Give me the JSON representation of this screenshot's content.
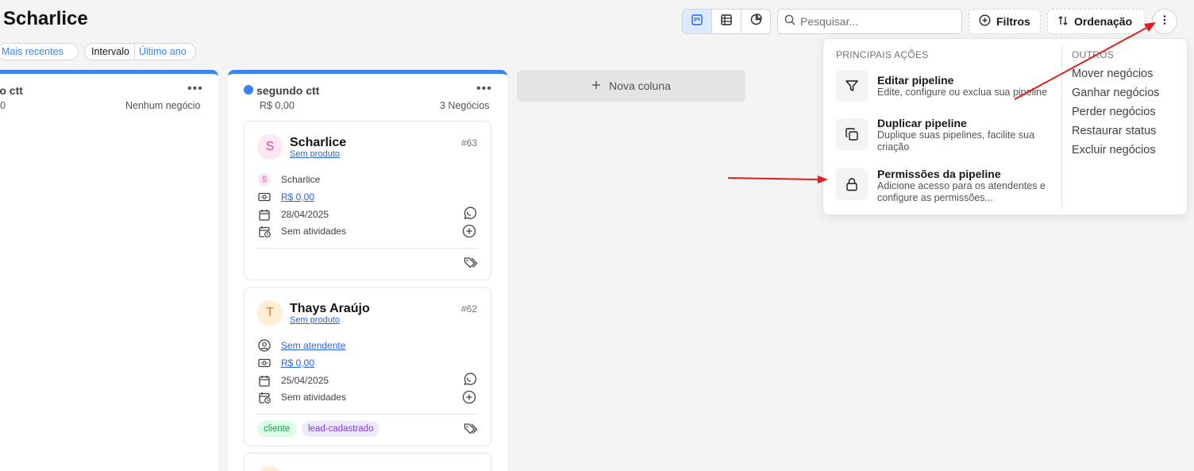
{
  "page": {
    "title": "Scharlice"
  },
  "filters": {
    "sort_value": "Mais recentes",
    "interval_label": "Intervalo",
    "interval_value": "Último ano"
  },
  "toolbar": {
    "view_icons": [
      "kanban-icon",
      "table-icon",
      "pie-chart-icon"
    ],
    "search_placeholder": "Pesquisar...",
    "filters_label": "Filtros",
    "sort_label": "Ordenação",
    "accent": "#3b82f6"
  },
  "columns": [
    {
      "name": "iro ctt",
      "value": "0",
      "count": "Nenhum negócio"
    },
    {
      "name": "segundo ctt",
      "value": "R$ 0,00",
      "count": "3 Negócios",
      "dot_color": "#3b82f6",
      "cards": [
        {
          "initial": "S",
          "name": "Scharlice",
          "product": "Sem produto",
          "id": "#63",
          "agent": "Scharlice",
          "value": "R$ 0,00",
          "date": "28/04/2025",
          "activities": "Sem atividades",
          "tags": []
        },
        {
          "initial": "T",
          "name": "Thays Araújo",
          "product": "Sem produto",
          "id": "#62",
          "agent": "Sem atendente",
          "value": "R$ 0,00",
          "date": "25/04/2025",
          "activities": "Sem atividades",
          "tags": [
            "cliente",
            "lead-cadastrado"
          ]
        }
      ]
    }
  ],
  "new_column_label": "Nova coluna",
  "menu": {
    "main_heading": "PRINCIPAIS AÇÕES",
    "main_items": [
      {
        "icon": "filter-icon",
        "title": "Editar pipeline",
        "desc": "Edite, configure ou exclua sua pipeline"
      },
      {
        "icon": "copy-icon",
        "title": "Duplicar pipeline",
        "desc": "Duplique suas pipelines, facilite sua criação"
      },
      {
        "icon": "lock-icon",
        "title": "Permissões da pipeline",
        "desc": "Adicione acesso para os atendentes e configure as permissões..."
      }
    ],
    "other_heading": "OUTROS",
    "other_items": [
      "Mover negócios",
      "Ganhar negócios",
      "Perder negócios",
      "Restaurar status",
      "Excluir negócios"
    ]
  },
  "annotation_color": "#e11d1d"
}
